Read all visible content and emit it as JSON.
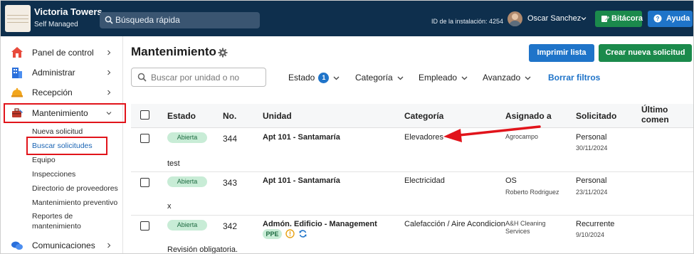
{
  "app": {
    "title": "Victoria Towers",
    "subtitle": "Self Managed",
    "quick_search_placeholder": "Búsqueda rápida",
    "installation_id": "ID de la instalación: 4254",
    "user_name": "Oscar Sanchez",
    "bitacora_label": "Bitácora",
    "help_label": "Ayuda"
  },
  "sidebar": {
    "items": [
      {
        "label": "Panel de control",
        "icon": "home-icon"
      },
      {
        "label": "Administrar",
        "icon": "building-icon"
      },
      {
        "label": "Recepción",
        "icon": "reception-bell-icon"
      },
      {
        "label": "Mantenimiento",
        "icon": "toolbox-icon"
      }
    ],
    "maintenance_sub": [
      "Nueva solicitud",
      "Buscar solicitudes",
      "Equipo",
      "Inspecciones",
      "Directorio de proveedores",
      "Mantenimiento preventivo",
      "Reportes de",
      "mantenimiento"
    ],
    "communications_label": "Comunicaciones"
  },
  "main": {
    "title": "Mantenimiento",
    "print_label": "Imprimir lista",
    "new_request_label": "Crear nueva solicitud",
    "unit_search_placeholder": "Buscar por unidad o no",
    "filters": {
      "estado": "Estado",
      "estado_count": "1",
      "categoria": "Categoría",
      "empleado": "Empleado",
      "avanzado": "Avanzado",
      "clear": "Borrar filtros"
    }
  },
  "table": {
    "columns": [
      "Estado",
      "No.",
      "Unidad",
      "Categoría",
      "Asignado a",
      "Solicitado",
      "Último comen"
    ],
    "rows": [
      {
        "status": "Abierta",
        "no": "344",
        "unit": "Apt 101 - Santamaría",
        "category": "Elevadores",
        "assigned": "Agrocampo",
        "assigned_sub": "",
        "requested": "Personal",
        "date": "30/11/2024",
        "comment": "test"
      },
      {
        "status": "Abierta",
        "no": "343",
        "unit": "Apt 101 - Santamaría",
        "category": "Electricidad",
        "assigned": "OS",
        "assigned_sub": "Roberto Rodriguez",
        "requested": "Personal",
        "date": "23/11/2024",
        "comment": "x"
      },
      {
        "status": "Abierta",
        "no": "342",
        "unit": "Admón. Edificio - Management",
        "category": "Calefacción / Aire Acondicion",
        "assigned": "A&H Cleaning",
        "assigned_sub": "Services",
        "requested": "Recurrente",
        "date": "9/10/2024",
        "comment": "Revisión obligatoria.",
        "tag": "PPE"
      }
    ]
  },
  "colors": {
    "topbar": "#0e2f4d",
    "primary_blue": "#1f74c9",
    "primary_green": "#1b8a4c",
    "highlight_red": "#e1141b",
    "status_bg": "#c8ecd6"
  }
}
